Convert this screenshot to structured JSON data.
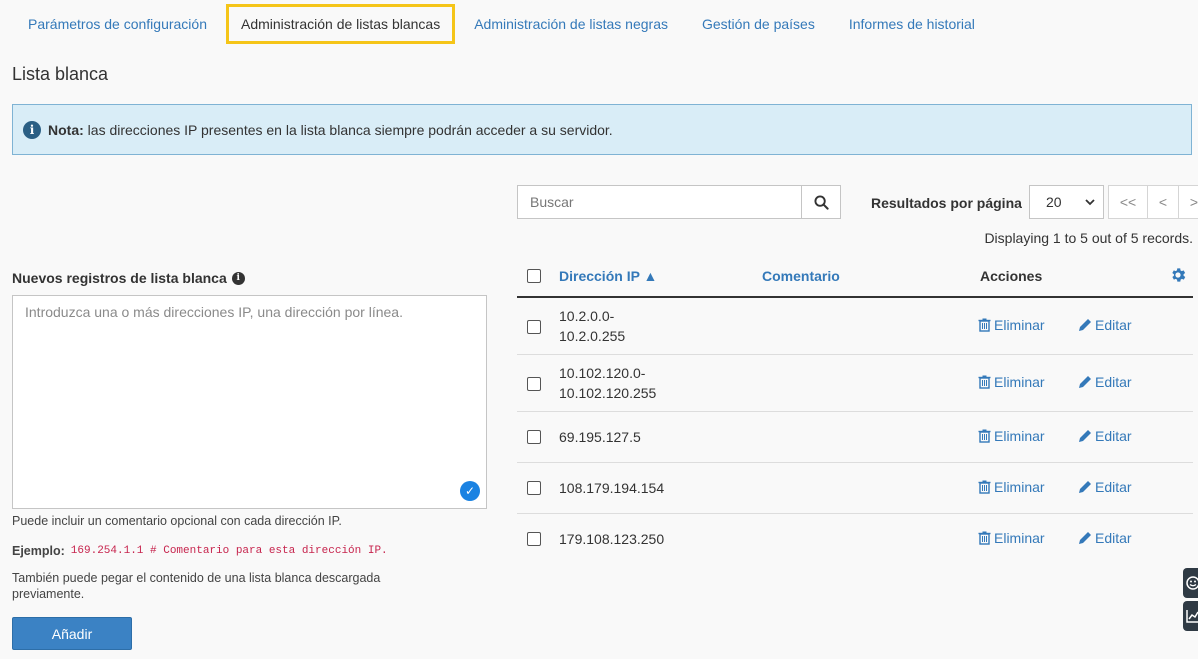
{
  "tabs": [
    {
      "label": "Parámetros de configuración"
    },
    {
      "label": "Administración de listas blancas"
    },
    {
      "label": "Administración de listas negras"
    },
    {
      "label": "Gestión de países"
    },
    {
      "label": "Informes de historial"
    }
  ],
  "page_title": "Lista blanca",
  "alert": {
    "bold": "Nota:",
    "text": " las direcciones IP presentes en la lista blanca siempre podrán acceder a su servidor."
  },
  "form": {
    "label": "Nuevos registros de lista blanca",
    "placeholder": "Introduzca una o más direcciones IP, una dirección por línea.",
    "help1": "Puede incluir un comentario opcional con cada dirección IP.",
    "example_label": "Ejemplo:",
    "example_code": "169.254.1.1 # Comentario para esta dirección IP.",
    "help2": "También puede pegar el contenido de una lista blanca descargada previamente.",
    "add_button": "Añadir"
  },
  "search": {
    "placeholder": "Buscar"
  },
  "results_per_page": {
    "label": "Resultados por página",
    "value": "20"
  },
  "pager": {
    "first": "<<",
    "prev": "<",
    "next": ">"
  },
  "records_text": "Displaying 1 to 5 out of 5 records.",
  "table": {
    "headers": {
      "ip": "Dirección IP ▲",
      "comment": "Comentario",
      "actions": "Acciones"
    },
    "delete_label": "Eliminar",
    "edit_label": "Editar",
    "rows": [
      {
        "ip": "10.2.0.0-\n10.2.0.255"
      },
      {
        "ip": "10.102.120.0-\n10.102.120.255"
      },
      {
        "ip": "69.195.127.5"
      },
      {
        "ip": "108.179.194.154"
      },
      {
        "ip": "179.108.123.250"
      }
    ]
  },
  "colors": {
    "accent": "#3479b9",
    "active_tab_border": "#f5c518",
    "alert_bg": "#d9edf7",
    "button": "#3b82c4"
  }
}
